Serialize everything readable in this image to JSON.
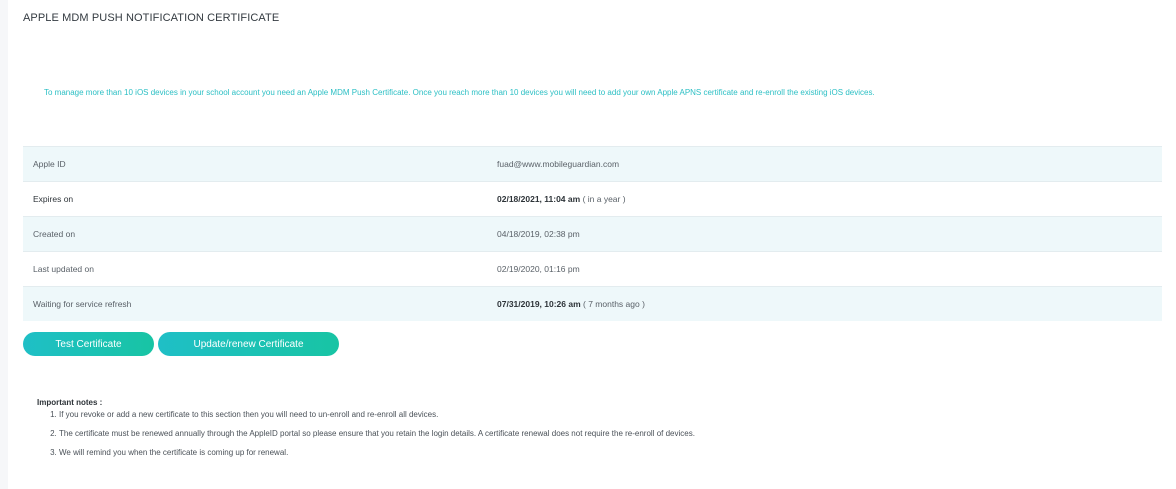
{
  "page": {
    "title": "APPLE MDM PUSH NOTIFICATION CERTIFICATE",
    "info": "To manage more than 10 iOS devices in your school account you need an Apple MDM Push Certificate. Once you reach more than 10 devices you will need to add your own Apple APNS certificate and re-enroll the existing iOS devices."
  },
  "details": [
    {
      "label": "Apple ID",
      "value": "fuad@www.mobileguardian.com",
      "note": ""
    },
    {
      "label": "Expires on",
      "value": "02/18/2021, 11:04 am",
      "note": "( in a year )"
    },
    {
      "label": "Created on",
      "value": "04/18/2019, 02:38 pm",
      "note": ""
    },
    {
      "label": "Last updated on",
      "value": "02/19/2020, 01:16 pm",
      "note": ""
    },
    {
      "label": "Waiting for service refresh",
      "value": "07/31/2019, 10:26 am",
      "note": "( 7 months ago )"
    }
  ],
  "buttons": {
    "test": "Test Certificate",
    "update": "Update/renew Certificate"
  },
  "notes": {
    "heading": "Important notes :",
    "items": [
      "If you revoke or add a new certificate to this section then you will need to un-enroll and re-enroll all devices.",
      "The certificate must be renewed annually through the AppleID portal so please ensure that you retain the login details. A certificate renewal does not require the re-enroll of devices.",
      "We will remind you when the certificate is coming up for renewal."
    ]
  },
  "colors": {
    "accent": "#1fbfc6",
    "info_text": "#2bbfc4",
    "row_stripe": "#eef8fa"
  }
}
